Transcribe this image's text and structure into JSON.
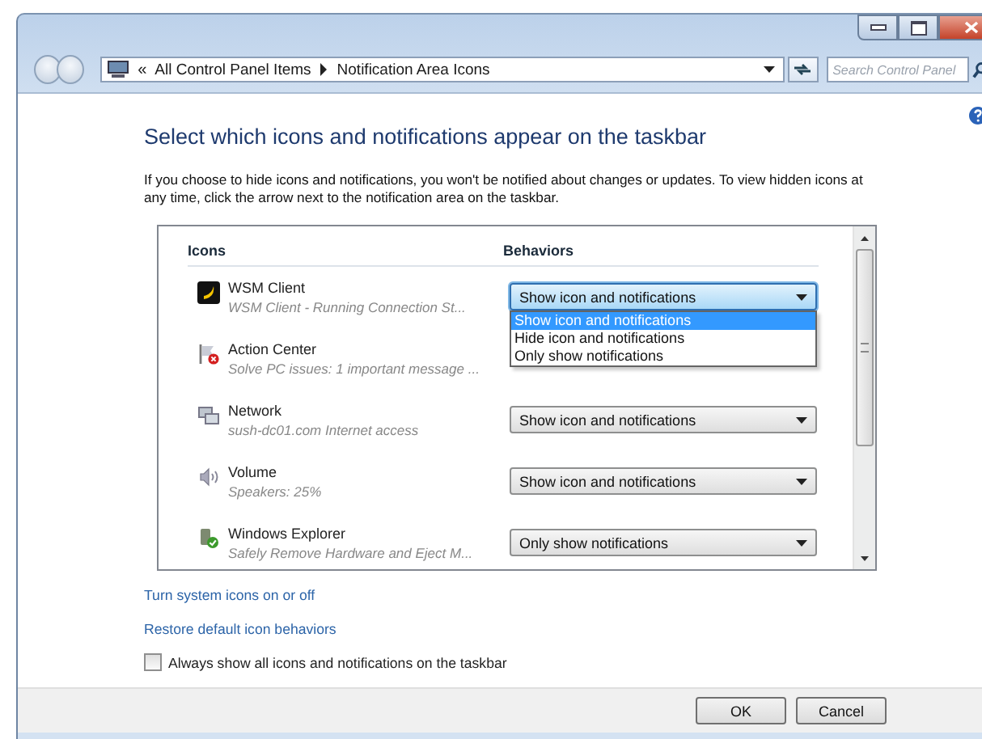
{
  "address_bar": {
    "chevron": "«",
    "crumbs": [
      "All Control Panel Items",
      "Notification Area Icons"
    ]
  },
  "search": {
    "placeholder": "Search Control Panel"
  },
  "heading": "Select which icons and notifications appear on the taskbar",
  "intro": "If you choose to hide icons and notifications, you won't be notified about changes or updates. To view hidden icons at any time, click the arrow next to the notification area on the taskbar.",
  "table": {
    "columns": [
      "Icons",
      "Behaviors"
    ],
    "rows": [
      {
        "name": "WSM Client",
        "description": "WSM Client - Running Connection St...",
        "behavior": "Show icon and notifications",
        "expanded": true,
        "options": [
          {
            "label": "Show icon and notifications",
            "selected": true
          },
          {
            "label": "Hide icon and notifications",
            "selected": false
          },
          {
            "label": "Only show notifications",
            "selected": false
          }
        ]
      },
      {
        "name": "Action Center",
        "description": "Solve PC issues: 1 important message ..."
      },
      {
        "name": "Network",
        "description": "sush-dc01.com Internet access",
        "behavior": "Show icon and notifications",
        "expanded": false
      },
      {
        "name": "Volume",
        "description": "Speakers: 25%",
        "behavior": "Show icon and notifications",
        "expanded": false
      },
      {
        "name": "Windows Explorer",
        "description": "Safely Remove Hardware and Eject M...",
        "behavior": "Only show notifications",
        "expanded": false
      }
    ]
  },
  "links": [
    "Turn system icons on or off",
    "Restore default icon behaviors"
  ],
  "always_show": {
    "label": "Always show all icons and notifications on the taskbar",
    "checked": false
  },
  "buttons": [
    "OK",
    "Cancel"
  ]
}
